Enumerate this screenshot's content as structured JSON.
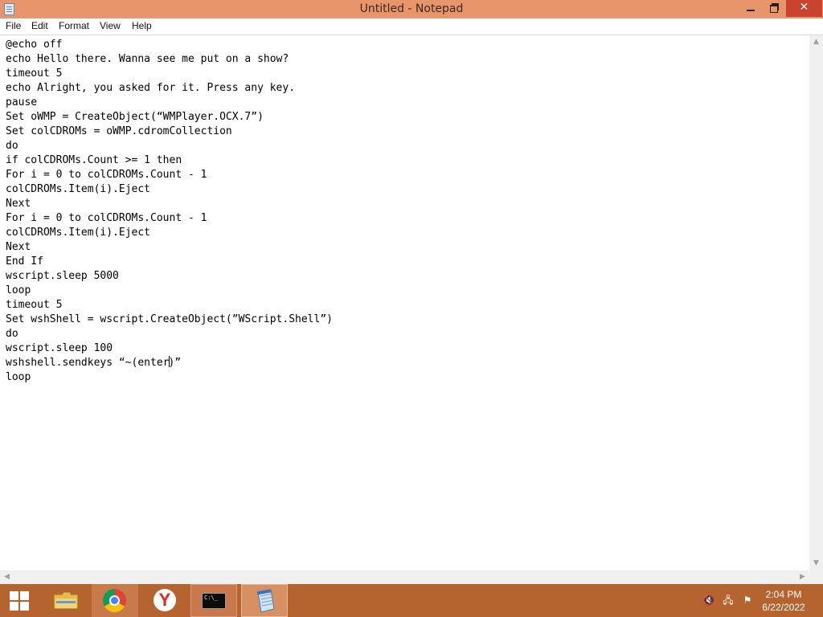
{
  "window": {
    "title": "Untitled - Notepad",
    "close_glyph": "✕"
  },
  "menu": {
    "items": [
      "File",
      "Edit",
      "Format",
      "View",
      "Help"
    ]
  },
  "editor": {
    "content_before_caret": "@echo off\necho Hello there. Wanna see me put on a show?\ntimeout 5\necho Alright, you asked for it. Press any key.\npause\nSet oWMP = CreateObject(“WMPlayer.OCX.7”)\nSet colCDROMs = oWMP.cdromCollection\ndo\nif colCDROMs.Count >= 1 then\nFor i = 0 to colCDROMs.Count - 1\ncolCDROMs.Item(i).Eject\nNext\nFor i = 0 to colCDROMs.Count - 1\ncolCDROMs.Item(i).Eject\nNext\nEnd If\nwscript.sleep 5000\nloop\ntimeout 5\nSet wshShell = wscript.CreateObject(”WScript.Shell”)\ndo\nwscript.sleep 100\nwshshell.sendkeys “~(enter",
    "content_after_caret": ")”\nloop"
  },
  "taskbar": {
    "apps": [
      {
        "id": "explorer",
        "icon": "folder-icon"
      },
      {
        "id": "chrome",
        "icon": "chrome-icon"
      },
      {
        "id": "yandex",
        "icon": "yandex-icon",
        "glyph": "Y"
      },
      {
        "id": "cmd",
        "icon": "cmd-icon",
        "glyph": "C:\\_"
      },
      {
        "id": "notepad",
        "icon": "notepad-icon"
      }
    ]
  },
  "tray": {
    "time": "2:04 PM",
    "date": "6/22/2022"
  },
  "colors": {
    "titlebar": "#e9956b",
    "close": "#c9432f",
    "taskbar": "#b5632f"
  }
}
